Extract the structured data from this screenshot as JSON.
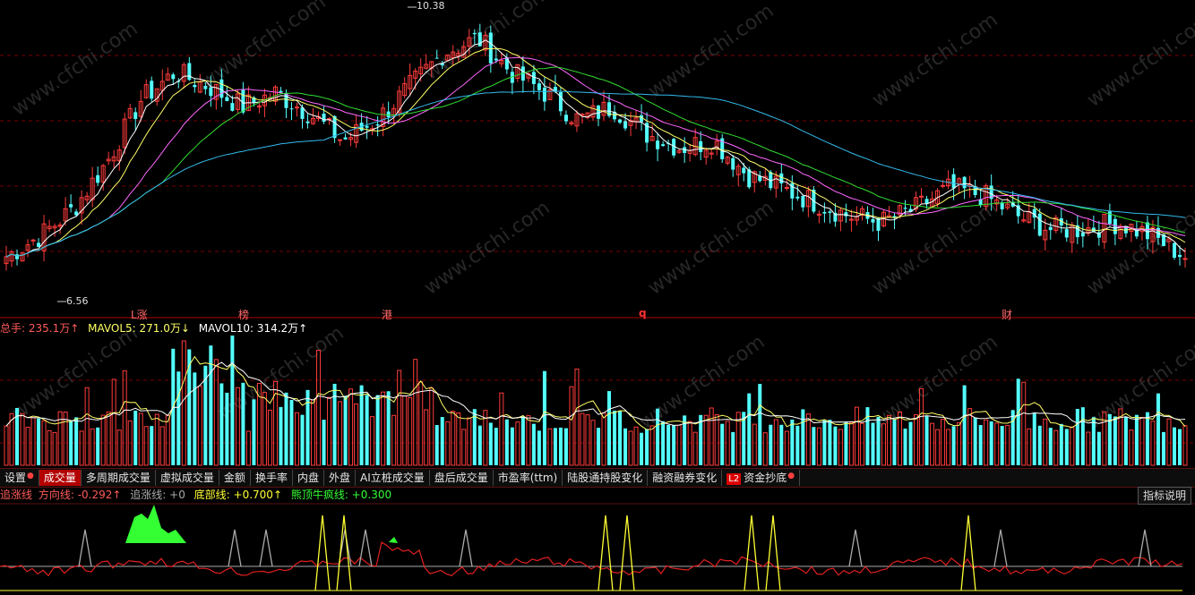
{
  "price_panel": {
    "high_label": "10.38",
    "low_label": "6.56",
    "markers": [
      "L涨",
      "榜",
      "港",
      "q",
      "财"
    ]
  },
  "volume_legend": {
    "total": "总手: 235.1万↑",
    "mavol5": "MAVOL5: 271.0万↓",
    "mavol10": "MAVOL10: 314.2万↑"
  },
  "tabs": [
    "设置",
    "成交量",
    "多周期成交量",
    "虚拟成交量",
    "金额",
    "换手率",
    "内盘",
    "外盘",
    "AI立桩成交量",
    "盘后成交量",
    "市盈率(ttm)",
    "陆股通持股变化",
    "融资融券变化",
    "资金抄底"
  ],
  "l2_badge": "L2",
  "indicator_legend": {
    "name": "追涨线",
    "direction": "方向线: -0.292↑",
    "chase": "追涨线: +0",
    "bottom": "底部线: +0.700↑",
    "bear_bull": "熊顶牛疯线: +0.300"
  },
  "help_button": "指标说明",
  "watermark": "www.cfchi.com",
  "colors": {
    "up": "#ff3b3b",
    "down": "#54ffff",
    "ma5": "#ffffff",
    "ma10": "#ffff66",
    "ma20": "#ff66ff",
    "ma30": "#33dd33",
    "ma60": "#33bbee",
    "grid": "#7a0000",
    "accent_tab": "#b30000"
  },
  "chart_data": {
    "type": "candlestick",
    "price_range": [
      6.2,
      10.6
    ],
    "high": 10.38,
    "low": 6.56,
    "close_path": [
      6.9,
      7.2,
      7.6,
      8.3,
      9.2,
      9.6,
      9.4,
      9.1,
      9.3,
      9.0,
      8.6,
      8.9,
      9.4,
      9.9,
      10.1,
      9.6,
      9.3,
      8.9,
      9.1,
      8.7,
      8.5,
      8.6,
      8.1,
      7.9,
      7.7,
      7.5,
      7.4,
      7.6,
      7.9,
      7.8,
      7.5,
      7.3,
      7.3,
      7.4,
      7.2,
      6.9
    ],
    "volume_legend_values": {
      "total": "235.1万",
      "mavol5": "271.0万",
      "mavol10": "314.2万"
    },
    "indicator_values": {
      "direction": -0.292,
      "chase": 0,
      "bottom": 0.7,
      "bear_bull": 0.3
    }
  }
}
